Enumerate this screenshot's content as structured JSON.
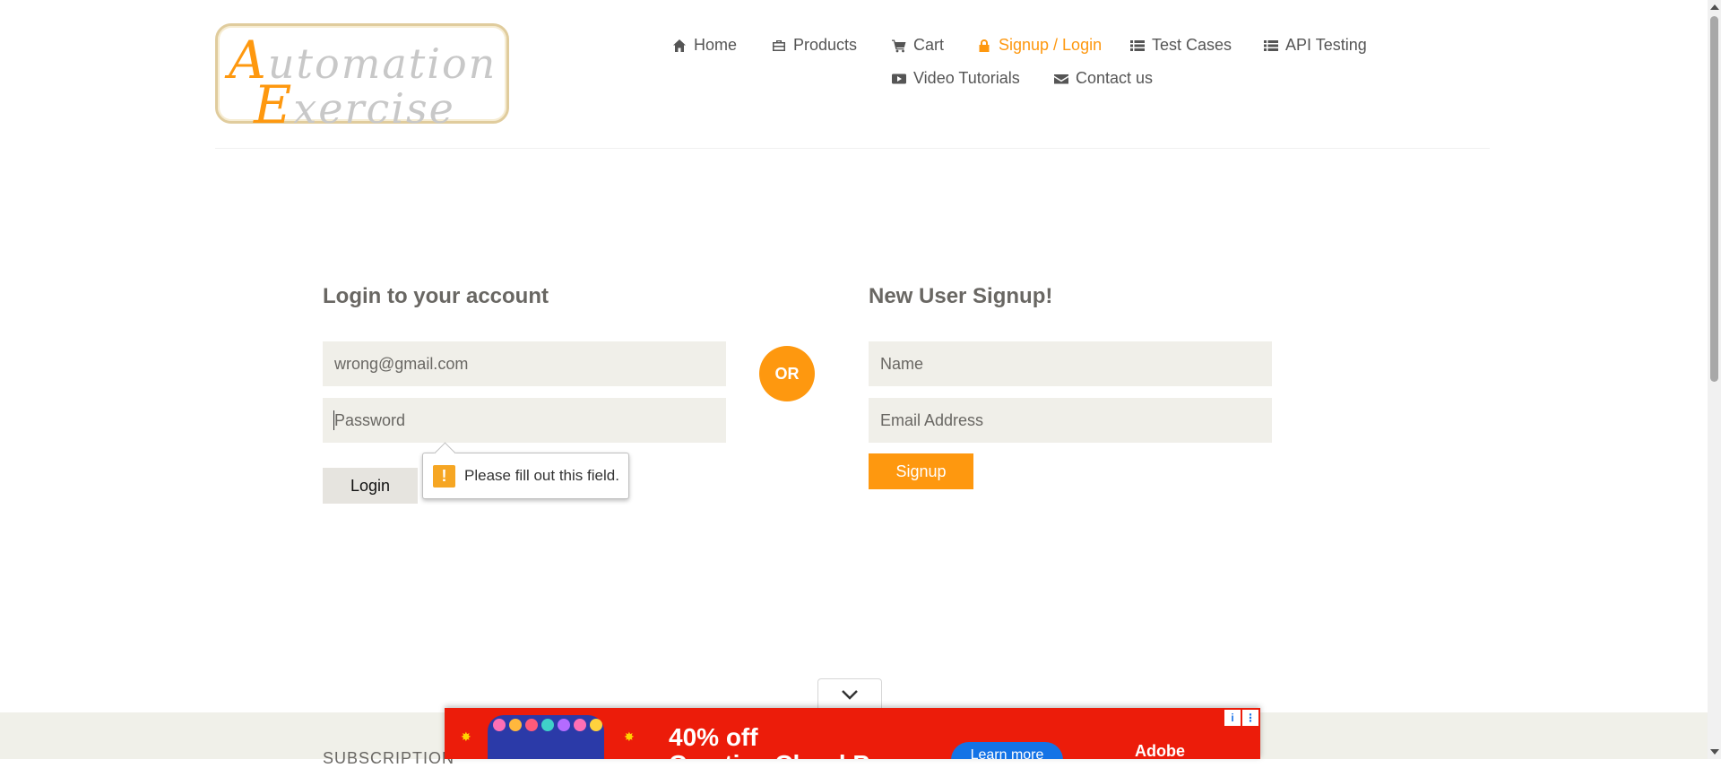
{
  "logo": {
    "line1_cap": "A",
    "line1_rest": "utomation",
    "line2_cap": "E",
    "line2_rest": "xercise"
  },
  "nav": {
    "items": [
      {
        "label": "Home",
        "icon": "home-icon"
      },
      {
        "label": "Products",
        "icon": "products-icon"
      },
      {
        "label": "Cart",
        "icon": "cart-icon"
      },
      {
        "label": "Signup / Login",
        "icon": "lock-icon",
        "active": true
      },
      {
        "label": "Test Cases",
        "icon": "list-icon"
      },
      {
        "label": "API Testing",
        "icon": "list-icon"
      },
      {
        "label": "Video Tutorials",
        "icon": "youtube-icon"
      },
      {
        "label": "Contact us",
        "icon": "envelope-icon"
      }
    ]
  },
  "login": {
    "title": "Login to your account",
    "email_value": "wrong@gmail.com",
    "password_placeholder": "Password",
    "button_label": "Login"
  },
  "divider": {
    "label": "OR"
  },
  "signup": {
    "title": "New User Signup!",
    "name_placeholder": "Name",
    "email_placeholder": "Email Address",
    "button_label": "Signup"
  },
  "tooltip": {
    "warning_glyph": "!",
    "message": "Please fill out this field."
  },
  "footer": {
    "subscription_label": "SUBSCRIPTION"
  },
  "ad": {
    "headline_line1": "40% off",
    "headline_line2": "Creative Cloud Pro",
    "cta_label": "Learn more",
    "brand": "Adobe",
    "info_glyph": "i",
    "more_glyph": "⋮"
  },
  "colors": {
    "accent": "#fe980f",
    "field_bg": "#f0efe9",
    "ad_bg": "#ec1c0a"
  }
}
